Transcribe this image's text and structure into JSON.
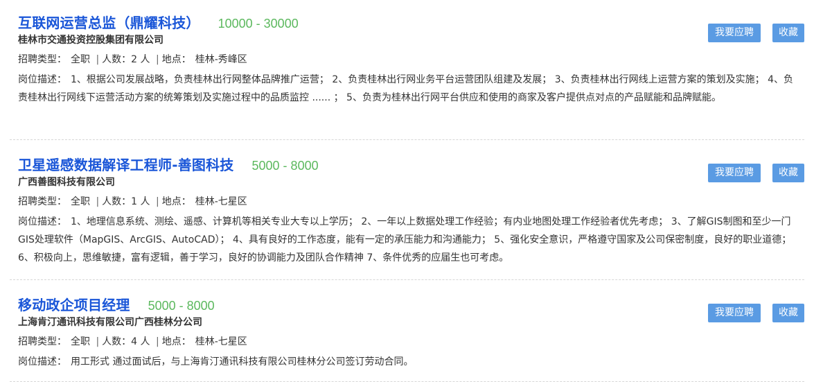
{
  "labels": {
    "recruit_type": "招聘类型：",
    "headcount": "人数：",
    "location": "地点：",
    "description": "岗位描述：",
    "person_unit": "人",
    "separator": "|"
  },
  "buttons": {
    "apply": "我要应聘",
    "favorite": "收藏"
  },
  "jobs": [
    {
      "title": "互联网运营总监（鼎耀科技）",
      "salary": "10000 - 30000",
      "company": "桂林市交通投资控股集团有限公司",
      "type": "全职",
      "count": "2",
      "location": "桂林-秀峰区",
      "description": "1、根据公司发展战略，负责桂林出行网整体品牌推广运营； 2、负责桂林出行网业务平台运营团队组建及发展； 3、负责桂林出行网线上运营方案的策划及实施； 4、负责桂林出行网线下运营活动方案的统筹策划及实施过程中的品质监控 ...... ； 5、负责为桂林出行网平台供应和使用的商家及客户提供点对点的产品赋能和品牌赋能。"
    },
    {
      "title": "卫星遥感数据解译工程师-善图科技",
      "salary": "5000 - 8000",
      "company": "广西善图科技有限公司",
      "type": "全职",
      "count": "1",
      "location": "桂林-七星区",
      "description": "1、地理信息系统、测绘、遥感、计算机等相关专业大专以上学历； 2、一年以上数据处理工作经验；有内业地图处理工作经验者优先考虑； 3、了解GIS制图和至少一门GIS处理软件（MapGIS、ArcGIS、AutoCAD）； 4、具有良好的工作态度，能有一定的承压能力和沟通能力； 5、强化安全意识，严格遵守国家及公司保密制度，良好的职业道德； 6、积极向上，思维敏捷，富有逻辑，善于学习，良好的协调能力及团队合作精神 7、条件优秀的应届生也可考虑。"
    },
    {
      "title": "移动政企项目经理",
      "salary": "5000 - 8000",
      "company": "上海肯汀通讯科技有限公司广西桂林分公司",
      "type": "全职",
      "count": "4",
      "location": "桂林-七星区",
      "description": "用工形式 通过面试后，与上海肯汀通讯科技有限公司桂林分公司签订劳动合同。"
    }
  ]
}
